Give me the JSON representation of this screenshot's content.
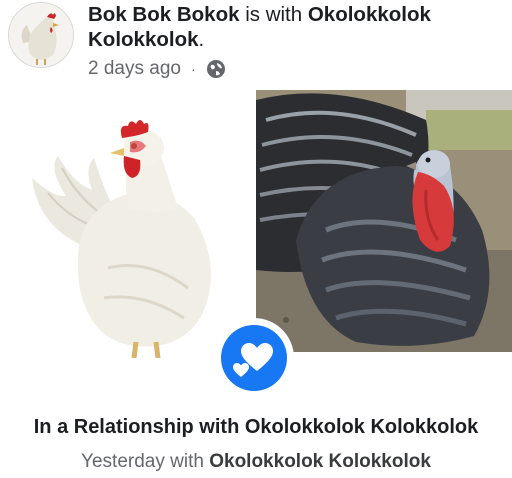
{
  "post": {
    "author": "Bok Bok Bokok",
    "connector": " is with ",
    "tagged": "Okolokkolok Kolokkolok",
    "period": ".",
    "time": "2 days ago",
    "separator": "·",
    "audience_icon": "globe-icon"
  },
  "images": {
    "left": "white-chicken-photo",
    "right": "turkey-photo",
    "badge_icon": "hearts-icon"
  },
  "relationship": {
    "title": "In a Relationship with Okolokkolok Kolokkolok",
    "when": "Yesterday",
    "with_word": " with ",
    "partner": "Okolokkolok Kolokkolok"
  },
  "colors": {
    "accent": "#1877f2",
    "secondary_text": "#65676b"
  }
}
